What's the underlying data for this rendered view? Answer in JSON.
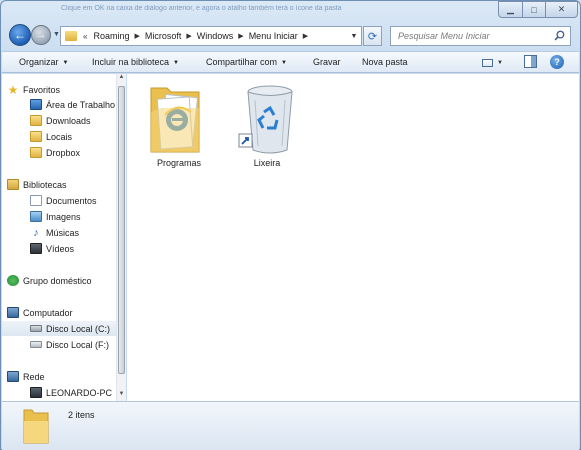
{
  "window": {
    "title_overlay": "Clique em OK na caixa de diálogo anterior, e agora o atalho também terá o ícone da pasta"
  },
  "nav": {
    "address_crumbs": [
      "Roaming",
      "Microsoft",
      "Windows",
      "Menu Iniciar"
    ],
    "overflow_marker": "«",
    "search_placeholder": "Pesquisar Menu Iniciar"
  },
  "toolbar": {
    "organize": "Organizar",
    "include_library": "Incluir na biblioteca",
    "share": "Compartilhar com",
    "burn": "Gravar",
    "new_folder": "Nova pasta"
  },
  "sidebar": {
    "favorites": {
      "label": "Favoritos",
      "items": [
        "Área de Trabalho",
        "Downloads",
        "Locais",
        "Dropbox"
      ]
    },
    "libraries": {
      "label": "Bibliotecas",
      "items": [
        "Documentos",
        "Imagens",
        "Músicas",
        "Vídeos"
      ]
    },
    "homegroup": {
      "label": "Grupo doméstico"
    },
    "computer": {
      "label": "Computador",
      "items": [
        "Disco Local (C:)",
        "Disco Local (F:)"
      ],
      "selected_index": 0
    },
    "network": {
      "label": "Rede",
      "items": [
        "LEONARDO-PC"
      ]
    }
  },
  "content": {
    "items": [
      {
        "name": "Programas",
        "icon": "folder-with-ie-icon"
      },
      {
        "name": "Lixeira",
        "icon": "recycle-bin-shortcut-icon"
      }
    ]
  },
  "details": {
    "count_text": "2 itens"
  },
  "colors": {
    "frame": "#c9dcf0",
    "toolbar": "#dfe9f5",
    "selection": "#dde7f1",
    "folder": "#e2b443"
  }
}
